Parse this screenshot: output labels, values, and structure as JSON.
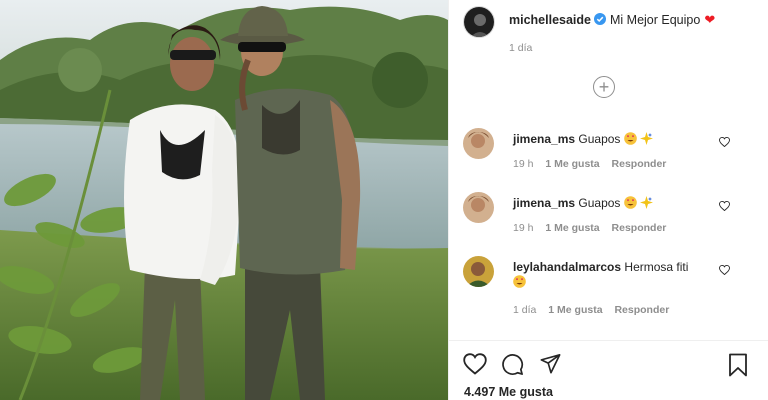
{
  "post": {
    "photo_alt_icon": "post-photo",
    "author": {
      "username": "michellesaide",
      "verified": true
    },
    "caption": "Mi Mejor Equipo",
    "caption_emoji": "❤",
    "time": "1 día",
    "load_more_icon": "plus-circle-icon",
    "likes_label": "4.497 Me gusta"
  },
  "comments": [
    {
      "username": "jimena_ms",
      "text": "Guapos",
      "emojis": [
        "heart-eyes",
        "sparkle"
      ],
      "time": "19 h",
      "likes": "1 Me gusta",
      "reply": "Responder"
    },
    {
      "username": "jimena_ms",
      "text": "Guapos",
      "emojis": [
        "heart-eyes",
        "sparkle"
      ],
      "time": "19 h",
      "likes": "1 Me gusta",
      "reply": "Responder"
    },
    {
      "username": "leylahandalmarcos",
      "text": "Hermosa fiti",
      "emojis": [
        "heart-eyes"
      ],
      "time": "1 día",
      "likes": "1 Me gusta",
      "reply": "Responder"
    }
  ],
  "actions": {
    "like_icon": "heart-outline-icon",
    "comment_icon": "comment-icon",
    "share_icon": "paper-plane-icon",
    "save_icon": "bookmark-icon"
  },
  "colors": {
    "text": "#262626",
    "secondary": "#8e8e8e",
    "verified": "#3897f0",
    "heart": "#ed1c24",
    "border": "#efefef"
  }
}
